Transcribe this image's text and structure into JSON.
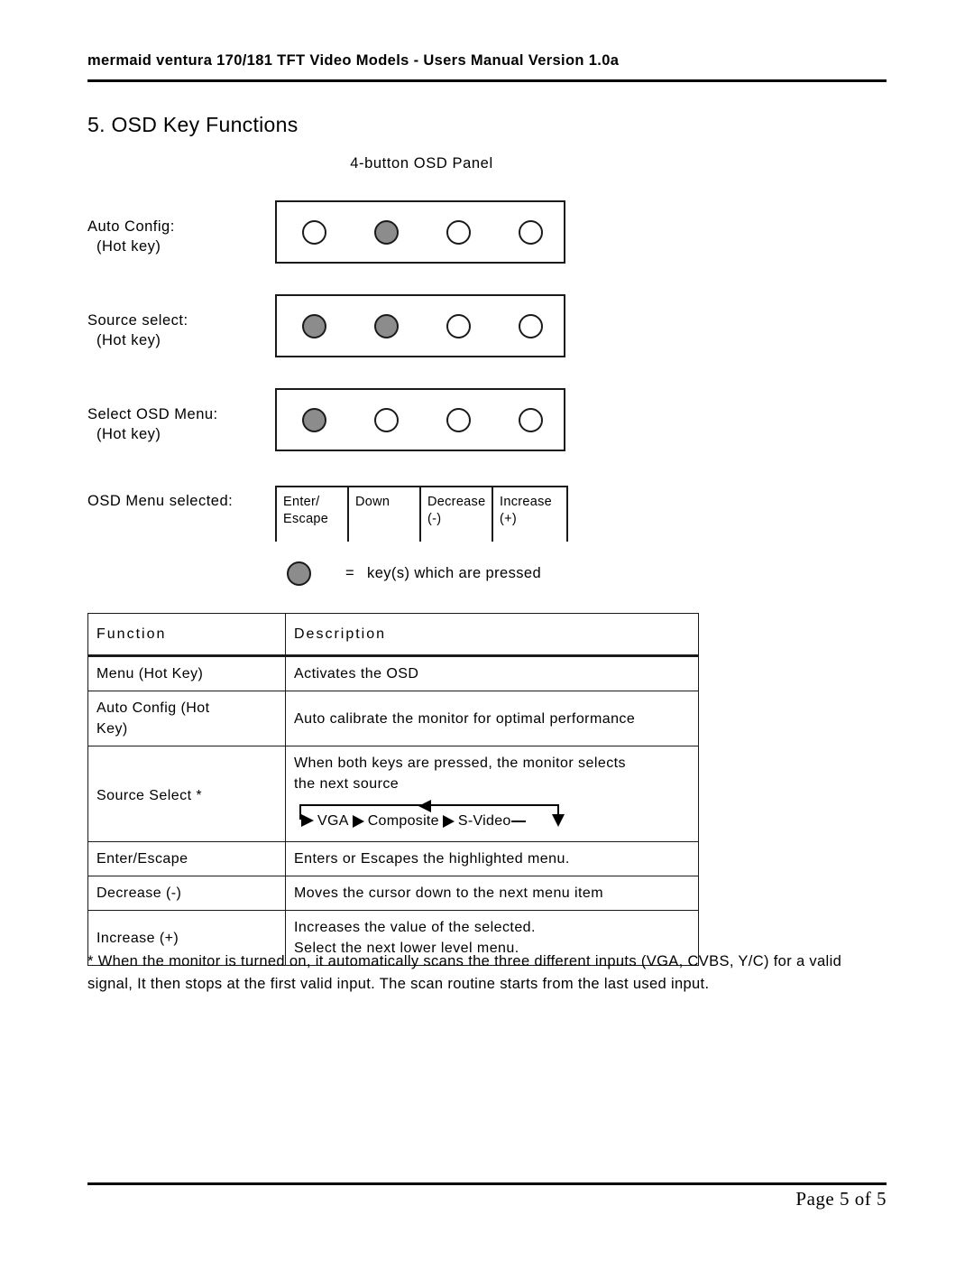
{
  "header": {
    "title": "mermaid ventura 170/181 TFT Video Models  -  Users Manual Version 1.0a"
  },
  "section": {
    "title": "5. OSD Key Functions"
  },
  "panel_diagram": {
    "caption": "4-button OSD Panel",
    "legend": {
      "equals": "=",
      "text": "key(s) which are pressed"
    },
    "rows": [
      {
        "label_line1": "Auto Config:",
        "label_line2": "(Hot key)",
        "pressed": [
          false,
          true,
          false,
          false
        ]
      },
      {
        "label_line1": "Source select:",
        "label_line2": "(Hot key)",
        "pressed": [
          true,
          true,
          false,
          false
        ]
      },
      {
        "label_line1": "Select OSD Menu:",
        "label_line2": "(Hot key)",
        "pressed": [
          true,
          false,
          false,
          false
        ]
      }
    ],
    "menu_selected": {
      "label": "OSD Menu  selected:",
      "keys": [
        "Enter/\nEscape",
        "Down",
        "Decrease\n(-)",
        "Increase\n(+)"
      ]
    }
  },
  "function_table": {
    "headers": [
      "Function",
      "Description"
    ],
    "rows": [
      {
        "function": "Menu (Hot Key)",
        "description": "Activates the OSD"
      },
      {
        "function": "Auto Config (Hot\nKey)",
        "description": "Auto calibrate the monitor for optimal performance"
      },
      {
        "function": "Source Select *",
        "description": "When both keys are pressed, the monitor selects\nthe next source",
        "cycle": [
          "VGA",
          "Composite",
          "S-Video"
        ]
      },
      {
        "function": "Enter/Escape",
        "description": "Enters or  Escapes the highlighted menu."
      },
      {
        "function": "Decrease (-)",
        "description": "Moves the cursor down to the next menu item"
      },
      {
        "function": "Increase (+)",
        "description": "Increases the value of the selected.\nSelect the next lower level menu."
      }
    ]
  },
  "footnote": {
    "text": "* When the monitor is turned on, it automatically scans the three different inputs  (VGA, CVBS, Y/C) for a valid signal,  It then stops at the first valid input. The scan routine starts from the last used input."
  },
  "footer": {
    "page_label": "Page 5 of  5"
  }
}
